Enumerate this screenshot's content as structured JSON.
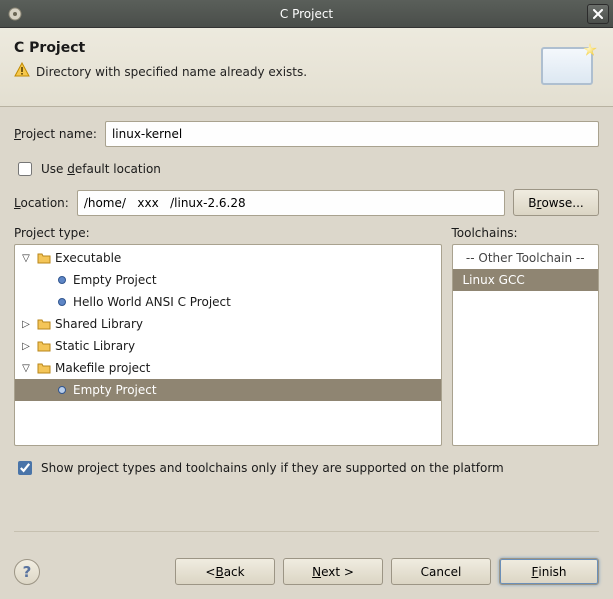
{
  "window": {
    "title": "C Project"
  },
  "header": {
    "title": "C Project",
    "message": "Directory with specified name already exists."
  },
  "form": {
    "project_name_label": "Project name:",
    "project_name_value": "linux-kernel",
    "use_default_label": "Use default location",
    "use_default_checked": false,
    "location_label": "Location:",
    "location_value": "/home/   xxx   /linux-2.6.28",
    "browse_label": "Browse..."
  },
  "project_type": {
    "label": "Project type:",
    "nodes": {
      "executable": {
        "label": "Executable",
        "expanded": true
      },
      "executable_empty": {
        "label": "Empty Project"
      },
      "executable_hello": {
        "label": "Hello World ANSI C Project"
      },
      "shared_lib": {
        "label": "Shared Library",
        "expanded": false
      },
      "static_lib": {
        "label": "Static Library",
        "expanded": false
      },
      "makefile": {
        "label": "Makefile project",
        "expanded": true
      },
      "makefile_empty": {
        "label": "Empty Project",
        "selected": true
      }
    }
  },
  "toolchains": {
    "label": "Toolchains:",
    "header": "-- Other Toolchain --",
    "items": {
      "linux_gcc": {
        "label": "Linux GCC",
        "selected": true
      }
    }
  },
  "filter": {
    "label": "Show project types and toolchains only if they are supported on the platform",
    "checked": true
  },
  "buttons": {
    "help": "?",
    "back": "< Back",
    "next": "Next >",
    "cancel": "Cancel",
    "finish": "Finish"
  }
}
